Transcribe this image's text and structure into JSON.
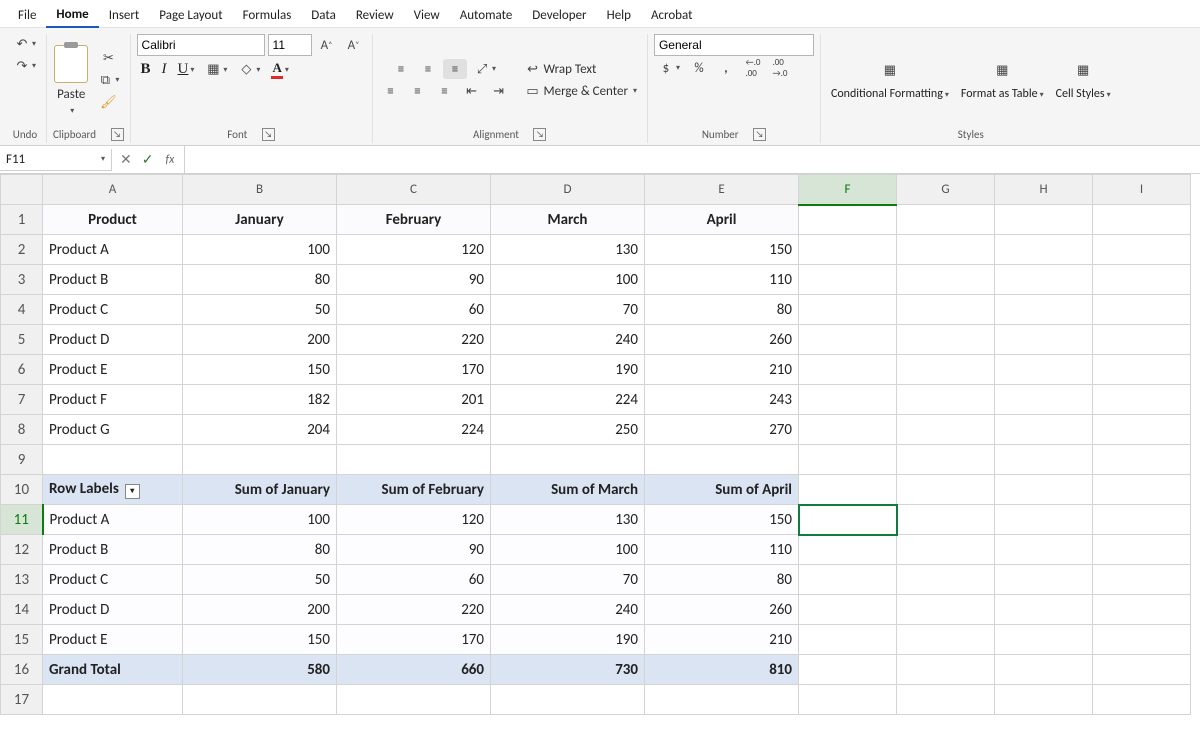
{
  "menu": {
    "tabs": [
      "File",
      "Home",
      "Insert",
      "Page Layout",
      "Formulas",
      "Data",
      "Review",
      "View",
      "Automate",
      "Developer",
      "Help",
      "Acrobat"
    ],
    "active": "Home"
  },
  "ribbon": {
    "undo_label": "Undo",
    "clipboard_label": "Clipboard",
    "paste_label": "Paste",
    "font_label": "Font",
    "font_name": "Calibri",
    "font_size": "11",
    "alignment_label": "Alignment",
    "wrap_text": "Wrap Text",
    "merge_center": "Merge & Center",
    "number_label": "Number",
    "number_format": "General",
    "styles_label": "Styles",
    "conditional_formatting": "Conditional Formatting",
    "format_as_table": "Format as Table",
    "cell_styles": "Cell Styles"
  },
  "namebox": "F11",
  "formula": "",
  "columns": [
    "A",
    "B",
    "C",
    "D",
    "E",
    "F",
    "G",
    "H",
    "I"
  ],
  "active_col": "F",
  "active_row": "11",
  "rows": {
    "headers": [
      "Product",
      "January",
      "February",
      "March",
      "April"
    ],
    "data": [
      {
        "p": "Product A",
        "jan": "100",
        "feb": "120",
        "mar": "130",
        "apr": "150"
      },
      {
        "p": "Product B",
        "jan": "80",
        "feb": "90",
        "mar": "100",
        "apr": "110"
      },
      {
        "p": "Product C",
        "jan": "50",
        "feb": "60",
        "mar": "70",
        "apr": "80"
      },
      {
        "p": "Product D",
        "jan": "200",
        "feb": "220",
        "mar": "240",
        "apr": "260"
      },
      {
        "p": "Product E",
        "jan": "150",
        "feb": "170",
        "mar": "190",
        "apr": "210"
      },
      {
        "p": "Product F",
        "jan": "182",
        "feb": "201",
        "mar": "224",
        "apr": "243"
      },
      {
        "p": "Product G",
        "jan": "204",
        "feb": "224",
        "mar": "250",
        "apr": "270"
      }
    ],
    "pivot_headers": [
      "Row Labels",
      "Sum of January",
      "Sum of February",
      "Sum of March",
      "Sum of April"
    ],
    "pivot_rows": [
      {
        "p": "Product A",
        "jan": "100",
        "feb": "120",
        "mar": "130",
        "apr": "150"
      },
      {
        "p": "Product B",
        "jan": "80",
        "feb": "90",
        "mar": "100",
        "apr": "110"
      },
      {
        "p": "Product C",
        "jan": "50",
        "feb": "60",
        "mar": "70",
        "apr": "80"
      },
      {
        "p": "Product D",
        "jan": "200",
        "feb": "220",
        "mar": "240",
        "apr": "260"
      },
      {
        "p": "Product E",
        "jan": "150",
        "feb": "170",
        "mar": "190",
        "apr": "210"
      }
    ],
    "pivot_total_label": "Grand Total",
    "pivot_totals": {
      "jan": "580",
      "feb": "660",
      "mar": "730",
      "apr": "810"
    }
  }
}
